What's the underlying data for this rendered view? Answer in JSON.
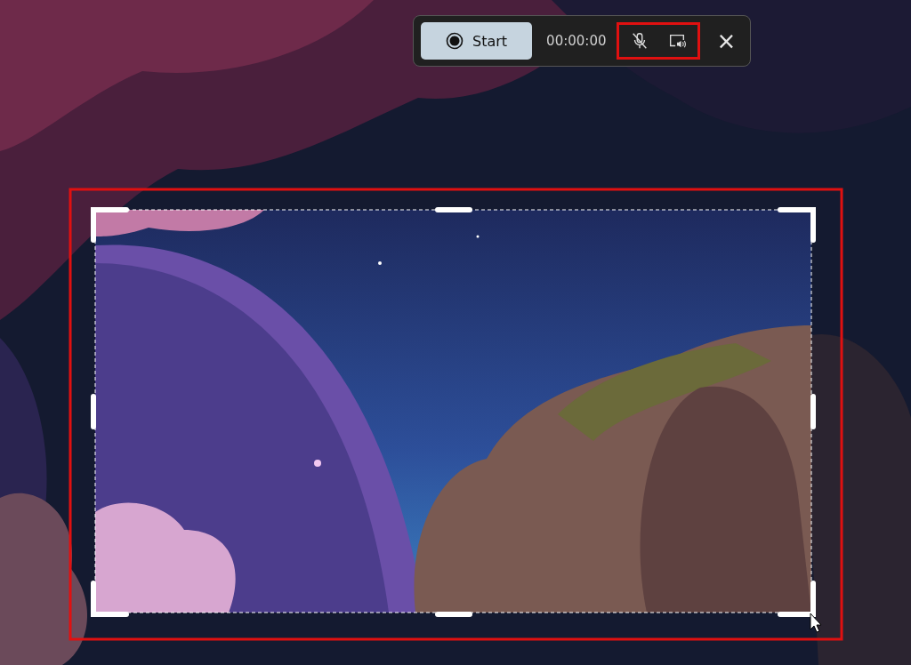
{
  "toolbar": {
    "start_button": {
      "label": "Start"
    },
    "timer": "00:00:00",
    "microphone": {
      "muted": true
    },
    "system_audio": {
      "on": true
    },
    "audio_controls_highlighted": true,
    "close_button": {
      "label": "×"
    }
  },
  "capture_region": {
    "highlighted": true
  }
}
